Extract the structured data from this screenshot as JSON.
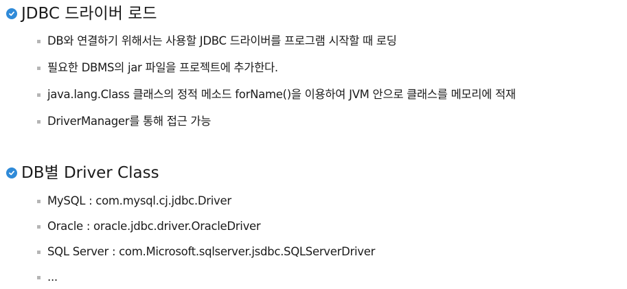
{
  "section1": {
    "title": "JDBC 드라이버 로드",
    "items": [
      "DB와 연결하기 위해서는 사용할 JDBC 드라이버를 프로그램 시작할 때 로딩",
      "필요한 DBMS의 jar 파일을 프로젝트에 추가한다.",
      "java.lang.Class 클래스의 정적 메소드 forName()을 이용하여 JVM 안으로 클래스를 메모리에 적재",
      "DriverManager를 통해 접근 가능"
    ]
  },
  "section2": {
    "title": "DB별 Driver Class",
    "items": [
      "MySQL : com.mysql.cj.jdbc.Driver",
      "Oracle : oracle.jdbc.driver.OracleDriver",
      "SQL Server : com.Microsoft.sqlserver.jsdbc.SQLServerDriver",
      "..."
    ]
  },
  "colors": {
    "check_icon": "#2f8ad8",
    "bullet": "#b5b5b5",
    "text": "#1a1a1a"
  },
  "icons": {
    "heading": "check-circle-icon",
    "item": "square-bullet-icon"
  }
}
